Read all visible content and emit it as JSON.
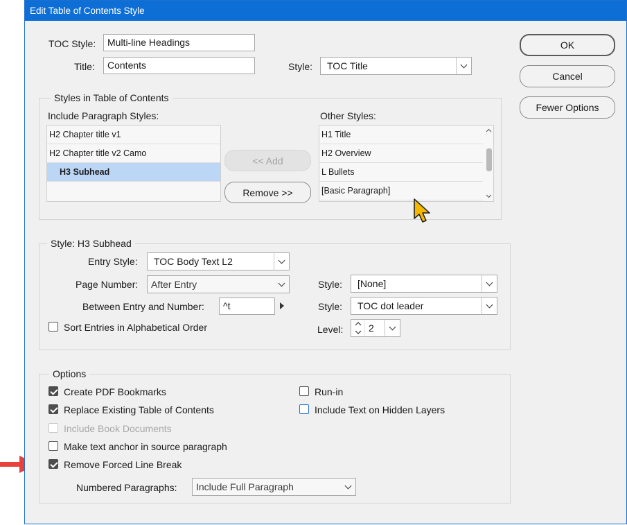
{
  "dialog": {
    "title": "Edit Table of Contents Style"
  },
  "toc_style": {
    "label": "TOC Style:",
    "value": "Multi-line Headings"
  },
  "title": {
    "label": "Title:",
    "value": "Contents"
  },
  "title_style": {
    "label": "Style:",
    "value": "TOC Title"
  },
  "buttons": {
    "ok": "OK",
    "cancel": "Cancel",
    "fewer_options": "Fewer Options",
    "add": "<< Add",
    "remove": "Remove >>"
  },
  "styles_group": {
    "label": "Styles in Table of Contents",
    "include_label": "Include Paragraph Styles:",
    "include_items": [
      "H2 Chapter title v1",
      "H2 Chapter title v2 Camo",
      "H3 Subhead"
    ],
    "other_label": "Other Styles:",
    "other_items": [
      "H1 Title",
      "H2 Overview",
      "L Bullets",
      "[Basic Paragraph]"
    ]
  },
  "style_group": {
    "label": "Style: H3 Subhead",
    "entry_style_label": "Entry Style:",
    "entry_style_value": "TOC Body Text L2",
    "page_number_label": "Page Number:",
    "page_number_value": "After Entry",
    "page_style_label": "Style:",
    "page_style_value": "[None]",
    "between_label": "Between Entry and Number:",
    "between_value": "^t",
    "between_style_label": "Style:",
    "between_style_value": "TOC dot leader",
    "sort_label": "Sort Entries in Alphabetical Order",
    "level_label": "Level:",
    "level_value": "2"
  },
  "options_group": {
    "label": "Options",
    "create_pdf": "Create PDF Bookmarks",
    "replace_existing": "Replace Existing Table of Contents",
    "include_book": "Include Book Documents",
    "make_anchor": "Make text anchor in source paragraph",
    "remove_forced": "Remove Forced Line Break",
    "run_in": "Run-in",
    "include_hidden": "Include Text on Hidden Layers",
    "numbered_label": "Numbered Paragraphs:",
    "numbered_value": "Include Full Paragraph"
  },
  "colors": {
    "titlebar": "#0d6fd6",
    "selection": "#bcd7f6",
    "arrow": "#e8413c",
    "cursor": "#f5b800"
  },
  "icons": [
    "chevron-down-icon",
    "arrow-right-icon",
    "spinner-icon",
    "cursor-pointer-icon",
    "red-arrow-icon"
  ]
}
